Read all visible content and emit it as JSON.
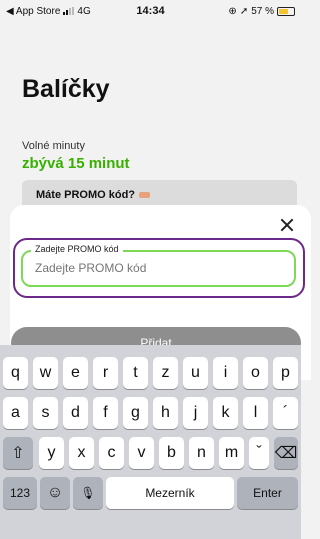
{
  "status_bar": {
    "back_app": "◀ App Store",
    "network": "4G",
    "time": "14:34",
    "battery": "57 %"
  },
  "page": {
    "title": "Balíčky",
    "minutes_label": "Volné minuty",
    "minutes_value": "zbývá 15 minut",
    "promo_card_label": "Máte PROMO kód?"
  },
  "sheet": {
    "field_label": "Zadejte PROMO kód",
    "field_placeholder": "Zadejte PROMO kód",
    "field_value": "",
    "add_button": "Přidat"
  },
  "keyboard": {
    "row1": [
      "q",
      "w",
      "e",
      "r",
      "t",
      "z",
      "u",
      "i",
      "o",
      "p"
    ],
    "row2": [
      "a",
      "s",
      "d",
      "f",
      "g",
      "h",
      "j",
      "k",
      "l",
      "´"
    ],
    "row3": [
      "y",
      "x",
      "c",
      "v",
      "b",
      "n",
      "m",
      "ˇ"
    ],
    "shift": "⇧",
    "backspace": "⌫",
    "numbers": "123",
    "emoji": "☺",
    "mic": "🎙",
    "space": "Mezerník",
    "enter": "Enter"
  },
  "colors": {
    "accent_green": "#38b000",
    "field_border": "#7ed957",
    "focus_ring": "#6b2a8a",
    "button_gray": "#8e8e8e"
  }
}
